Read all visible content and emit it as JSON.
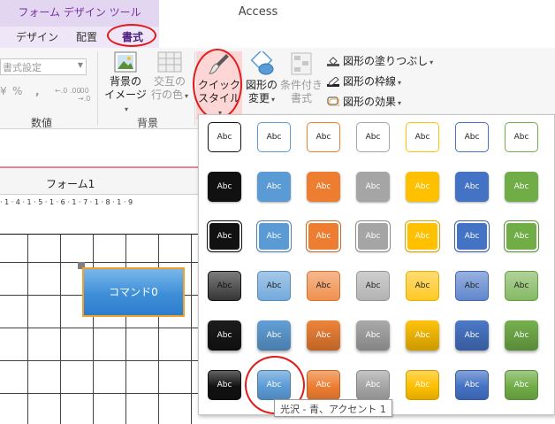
{
  "title": {
    "context_group": "フォーム デザイン ツール",
    "app": "Access"
  },
  "tabs": [
    {
      "label": "デザイン"
    },
    {
      "label": "配置"
    },
    {
      "label": "書式",
      "active": true
    }
  ],
  "ribbon": {
    "format_select_value": "書式設定",
    "number_buttons": [
      "¥",
      "%",
      ",",
      "←.0 .00",
      ".00 →.0"
    ],
    "groups": {
      "number": "数値",
      "background": "背景"
    },
    "background_image": "背景の\nイメージ",
    "alternate_row_color": "交互の\n行の色",
    "quick_style": "クイック\nスタイル",
    "change_shape": "図形の\n変更",
    "conditional_format": "条件付き\n書式",
    "shape_fill": "図形の塗りつぶし",
    "shape_outline": "図形の枠線",
    "shape_effects": "図形の効果"
  },
  "form": {
    "tab_label": "フォーム1",
    "ruler_text": "· 1 · 4 · 1 · 5 · 1 · 6 · 1 · 7 · 1 · 8 · 1 · 9",
    "command_button_label": "コマンド0"
  },
  "gallery": {
    "swatch_label": "Abc",
    "tooltip": "光沢 - 青、アクセント 1",
    "colors": {
      "black": "#111111",
      "blue": "#5b9bd5",
      "orange": "#ed7d31",
      "gray": "#a5a5a5",
      "gold": "#ffc000",
      "darkblue": "#4472c4",
      "green": "#70ad47"
    }
  }
}
